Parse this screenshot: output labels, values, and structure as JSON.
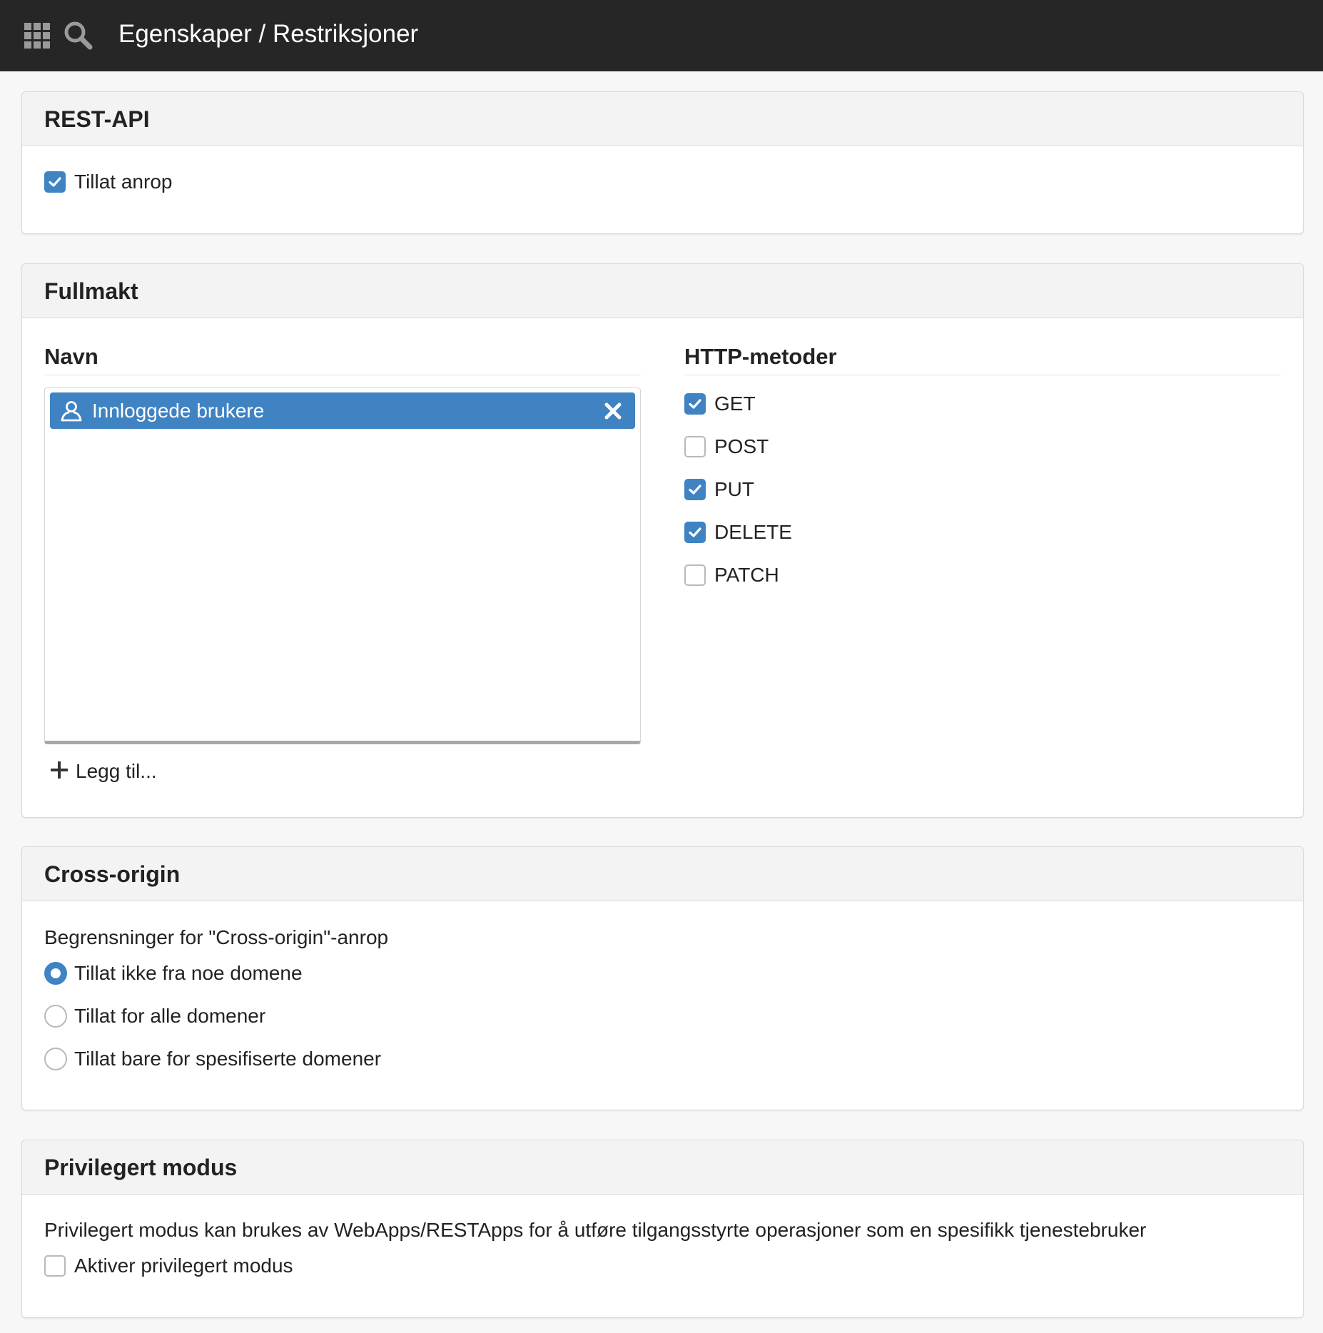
{
  "header": {
    "title": "Egenskaper / Restriksjoner",
    "icons": [
      "grid-icon",
      "search-icon"
    ]
  },
  "rest_api": {
    "title": "REST-API",
    "allow_calls": {
      "label": "Tillat anrop",
      "checked": true
    }
  },
  "fullmakt": {
    "title": "Fullmakt",
    "name_column": {
      "title": "Navn",
      "items": [
        {
          "label": "Innloggede brukere",
          "icon": "user-icon"
        }
      ],
      "add_label": "Legg til..."
    },
    "methods_column": {
      "title": "HTTP-metoder",
      "methods": [
        {
          "label": "GET",
          "checked": true
        },
        {
          "label": "POST",
          "checked": false
        },
        {
          "label": "PUT",
          "checked": true
        },
        {
          "label": "DELETE",
          "checked": true
        },
        {
          "label": "PATCH",
          "checked": false
        }
      ]
    }
  },
  "cross_origin": {
    "title": "Cross-origin",
    "description": "Begrensninger for \"Cross-origin\"-anrop",
    "options": [
      {
        "label": "Tillat ikke fra noe domene",
        "selected": true
      },
      {
        "label": "Tillat for alle domener",
        "selected": false
      },
      {
        "label": "Tillat bare for spesifiserte domener",
        "selected": false
      }
    ]
  },
  "privileged": {
    "title": "Privilegert modus",
    "description": "Privilegert modus kan brukes av WebApps/RESTApps for å utføre tilgangsstyrte operasjoner som en spesifikk tjenestebruker",
    "enable": {
      "label": "Aktiver privilegert modus",
      "checked": false
    }
  },
  "colors": {
    "topbar": "#262626",
    "accent": "#3f83c3",
    "panel_header": "#f3f3f3"
  }
}
